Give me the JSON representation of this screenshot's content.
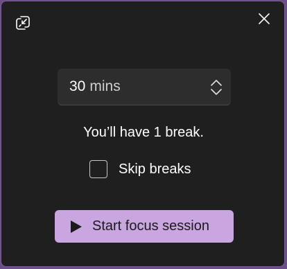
{
  "window": {
    "accent_color": "#c9a6e0",
    "background_color": "#1f1f1f"
  },
  "toolbar": {
    "restore_icon": "restore-window-icon",
    "close_icon": "close-icon"
  },
  "duration": {
    "value": "30",
    "unit": "mins",
    "spin_icon": "chevron-up-down-icon"
  },
  "break_info": "You’ll have 1 break.",
  "skip_breaks": {
    "label": "Skip breaks",
    "checked": false
  },
  "start_button": {
    "label": "Start focus session",
    "icon": "play-icon"
  }
}
